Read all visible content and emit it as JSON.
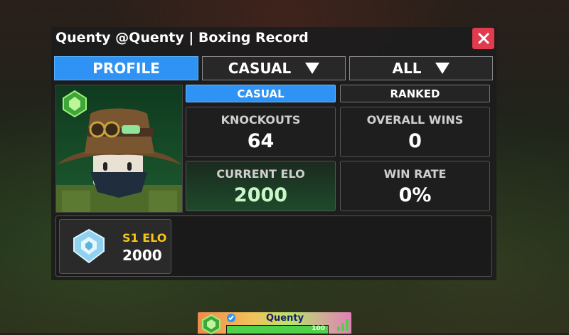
{
  "window": {
    "title": "Quenty @Quenty | Boxing Record"
  },
  "tabs": {
    "profile": "PROFILE",
    "mode": "CASUAL",
    "filter": "ALL"
  },
  "mode_tabs": {
    "casual": "CASUAL",
    "ranked": "RANKED"
  },
  "stats": {
    "knockouts": {
      "label": "KNOCKOUTS",
      "value": "64"
    },
    "overall_wins": {
      "label": "OVERALL WINS",
      "value": "0"
    },
    "current_elo": {
      "label": "CURRENT ELO",
      "value": "2000"
    },
    "win_rate": {
      "label": "WIN RATE",
      "value": "0%"
    }
  },
  "season": {
    "label": "S1 ELO",
    "value": "2000"
  },
  "player_card": {
    "name": "Quenty",
    "health": "100",
    "health_fraction": 1.0
  },
  "colors": {
    "accent_blue": "#2f93f5",
    "close_red": "#e23b4d",
    "season_gold": "#f5c518",
    "elo_green": "#1d4a2a"
  },
  "icons": [
    "close-icon",
    "dropdown-caret-icon",
    "rank-emblem-icon",
    "verified-badge-icon",
    "signal-icon"
  ]
}
